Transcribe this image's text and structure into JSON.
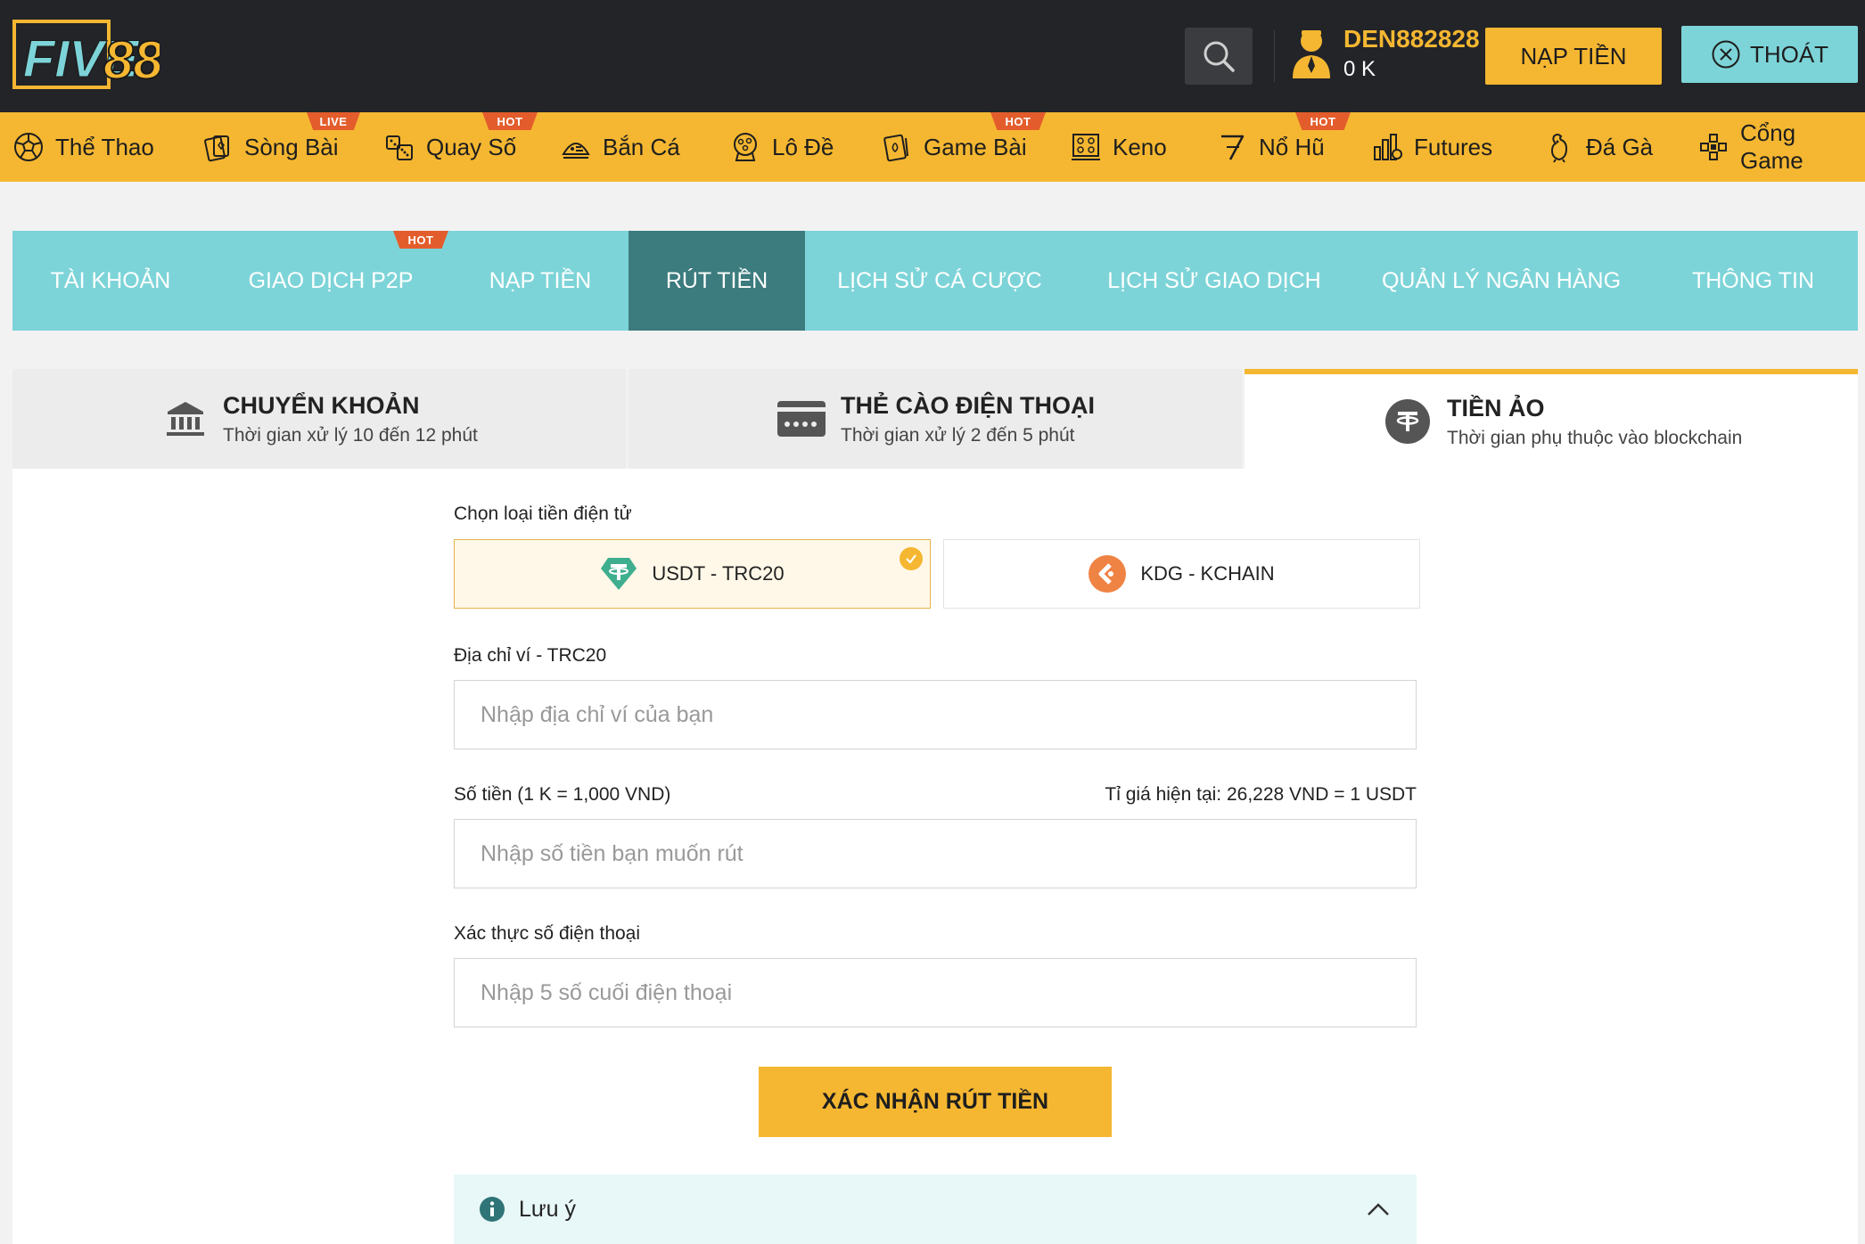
{
  "header": {
    "logo_text": "FIVE88",
    "username": "DEN882828",
    "balance": "0 K",
    "deposit_label": "NẠP TIỀN",
    "logout_label": "THOÁT"
  },
  "nav": {
    "items": [
      {
        "label": "Thể Thao",
        "icon": "soccer-ball-icon",
        "badge": ""
      },
      {
        "label": "Sòng Bài",
        "icon": "cards-icon",
        "badge": "LIVE"
      },
      {
        "label": "Quay Số",
        "icon": "lottery-icon",
        "badge": "HOT"
      },
      {
        "label": "Bắn Cá",
        "icon": "fish-icon",
        "badge": ""
      },
      {
        "label": "Lô Đề",
        "icon": "lotto-ball-icon",
        "badge": ""
      },
      {
        "label": "Game Bài",
        "icon": "card-game-icon",
        "badge": "HOT"
      },
      {
        "label": "Keno",
        "icon": "keno-grid-icon",
        "badge": ""
      },
      {
        "label": "Nổ Hũ",
        "icon": "slot-seven-icon",
        "badge": "HOT"
      },
      {
        "label": "Futures",
        "icon": "futures-chart-icon",
        "badge": ""
      },
      {
        "label": "Đá Gà",
        "icon": "rooster-icon",
        "badge": ""
      },
      {
        "label": "Cổng Game",
        "icon": "gamepad-icon",
        "badge": ""
      }
    ]
  },
  "account_tabs": [
    {
      "label": "TÀI KHOẢN",
      "badge": ""
    },
    {
      "label": "GIAO DỊCH P2P",
      "badge": "HOT"
    },
    {
      "label": "NẠP TIỀN",
      "badge": ""
    },
    {
      "label": "RÚT TIỀN",
      "badge": ""
    },
    {
      "label": "LỊCH SỬ CÁ CƯỢC",
      "badge": ""
    },
    {
      "label": "LỊCH SỬ GIAO DỊCH",
      "badge": ""
    },
    {
      "label": "QUẢN LÝ NGÂN HÀNG",
      "badge": ""
    },
    {
      "label": "THÔNG TIN",
      "badge": ""
    }
  ],
  "methods": [
    {
      "title": "CHUYỂN KHOẢN",
      "subtitle": "Thời gian xử lý 10 đến 12 phút",
      "icon": "bank-icon"
    },
    {
      "title": "THẺ CÀO ĐIỆN THOẠI",
      "subtitle": "Thời gian xử lý 2 đến 5 phút",
      "icon": "phone-card-icon"
    },
    {
      "title": "TIỀN ẢO",
      "subtitle": "Thời gian phụ thuộc vào blockchain",
      "icon": "crypto-icon"
    }
  ],
  "form": {
    "coin_label": "Chọn loại tiền điện tử",
    "coins": [
      {
        "label": "USDT - TRC20",
        "icon": "tether-icon"
      },
      {
        "label": "KDG - KCHAIN",
        "icon": "kdg-icon"
      }
    ],
    "wallet_label": "Địa chỉ ví - TRC20",
    "wallet_placeholder": "Nhập địa chỉ ví của bạn",
    "amount_label": "Số tiền (1 K = 1,000 VND)",
    "rate_text": "Tỉ giá hiện tại: 26,228 VND = 1 USDT",
    "amount_placeholder": "Nhập số tiền bạn muốn rút",
    "phone_label": "Xác thực số điện thoại",
    "phone_placeholder": "Nhập 5 số cuối điện thoại",
    "submit_label": "XÁC NHẬN RÚT TIỀN",
    "note_label": "Lưu ý"
  },
  "colors": {
    "accent": "#f5b731",
    "teal": "#7dd4d8",
    "teal_dark": "#3c7b7e",
    "header_bg": "#222428",
    "badge": "#e35d2c"
  }
}
